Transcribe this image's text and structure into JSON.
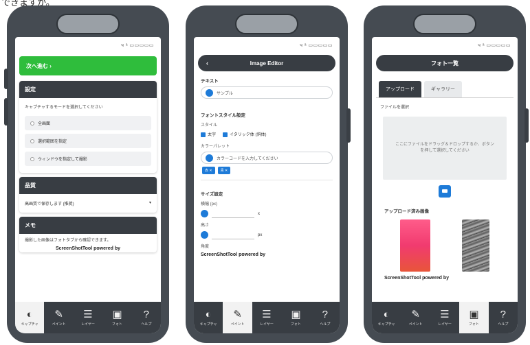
{
  "caption": "できますか。",
  "status_text": "ч  ᵃ ▭▭▭▭▭",
  "tabs": [
    {
      "label": "キャプチャ",
      "icon": "◐"
    },
    {
      "label": "ペイント",
      "icon": "✎"
    },
    {
      "label": "レイヤー",
      "icon": "☰"
    },
    {
      "label": "フォト",
      "icon": "▣"
    },
    {
      "label": "ヘルプ",
      "icon": "?"
    }
  ],
  "screen1": {
    "green_button": "次へ進む ›",
    "card1": {
      "title": "設定",
      "description": "キャプチャするモードを選択してください",
      "options": [
        "全画面",
        "選択範囲を指定",
        "ウィンドウを指定して撮影"
      ]
    },
    "card2": {
      "title": "品質",
      "select_value": "高画質で保存します (推奨)",
      "select_arrow": "▾"
    },
    "card3": {
      "title": "メモ",
      "text": "撮影した画像はフォトタブから確認できます。",
      "footer": "ScreenShotTool  powered by"
    }
  },
  "screen2": {
    "title": "Image Editor",
    "back": "‹",
    "label_text": "テキスト",
    "input_value": "サンプル",
    "label_style": "フォントスタイル設定",
    "sub_style": "スタイル",
    "checks": [
      "太字",
      "イタリック体 (斜体)"
    ],
    "label_color": "カラーパレット",
    "color_input": "カラーコードを入力してください",
    "chips": [
      "赤 ✕",
      "青 ✕"
    ],
    "label_size": "サイズ設定",
    "sub_width": "横幅 (px)",
    "sub_height": "高さ",
    "unit_w": "x",
    "unit_h": "px",
    "sub_angle": "角度",
    "footer": "ScreenShotTool  powered by"
  },
  "screen3": {
    "title": "フォト一覧",
    "tab_on": "アップロード",
    "tab_off": "ギャラリー",
    "lbl": "ファイルを選択",
    "dropzone": "ここにファイルをドラッグ＆ドロップするか、ボタンを押して選択してください",
    "section": "アップロード済み画像",
    "footer": "ScreenShotTool  powered by"
  }
}
